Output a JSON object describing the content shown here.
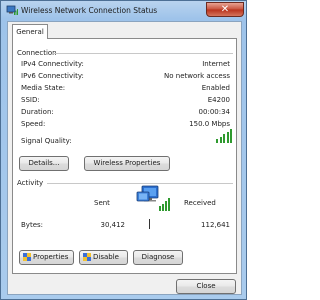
{
  "window": {
    "title": "Wireless Network Connection Status"
  },
  "tabs": [
    {
      "label": "General"
    }
  ],
  "connection": {
    "heading": "Connection",
    "rows": [
      {
        "label": "IPv4 Connectivity:",
        "value": "Internet"
      },
      {
        "label": "IPv6 Connectivity:",
        "value": "No network access"
      },
      {
        "label": "Media State:",
        "value": "Enabled"
      },
      {
        "label": "SSID:",
        "value": "E4200"
      },
      {
        "label": "Duration:",
        "value": "00:00:34"
      },
      {
        "label": "Speed:",
        "value": "150.0 Mbps"
      }
    ],
    "signal_label": "Signal Quality:",
    "signal_bars": 5,
    "signal_max": 5,
    "details_button": "Details...",
    "wireless_button": "Wireless Properties"
  },
  "activity": {
    "heading": "Activity",
    "sent_label": "Sent",
    "received_label": "Received",
    "bytes_label": "Bytes:",
    "sent_bytes": "30,412",
    "received_bytes": "112,641"
  },
  "buttons": {
    "properties": "Properties",
    "disable": "Disable",
    "diagnose": "Diagnose",
    "close": "Close"
  },
  "colors": {
    "signal": "#2f9a2f",
    "title_bar": "#a9cbed",
    "close_button": "#c7503b"
  },
  "icons": [
    "wireless-network-icon",
    "close-icon",
    "signal-strength-icon",
    "network-computers-icon",
    "shield-icon"
  ]
}
